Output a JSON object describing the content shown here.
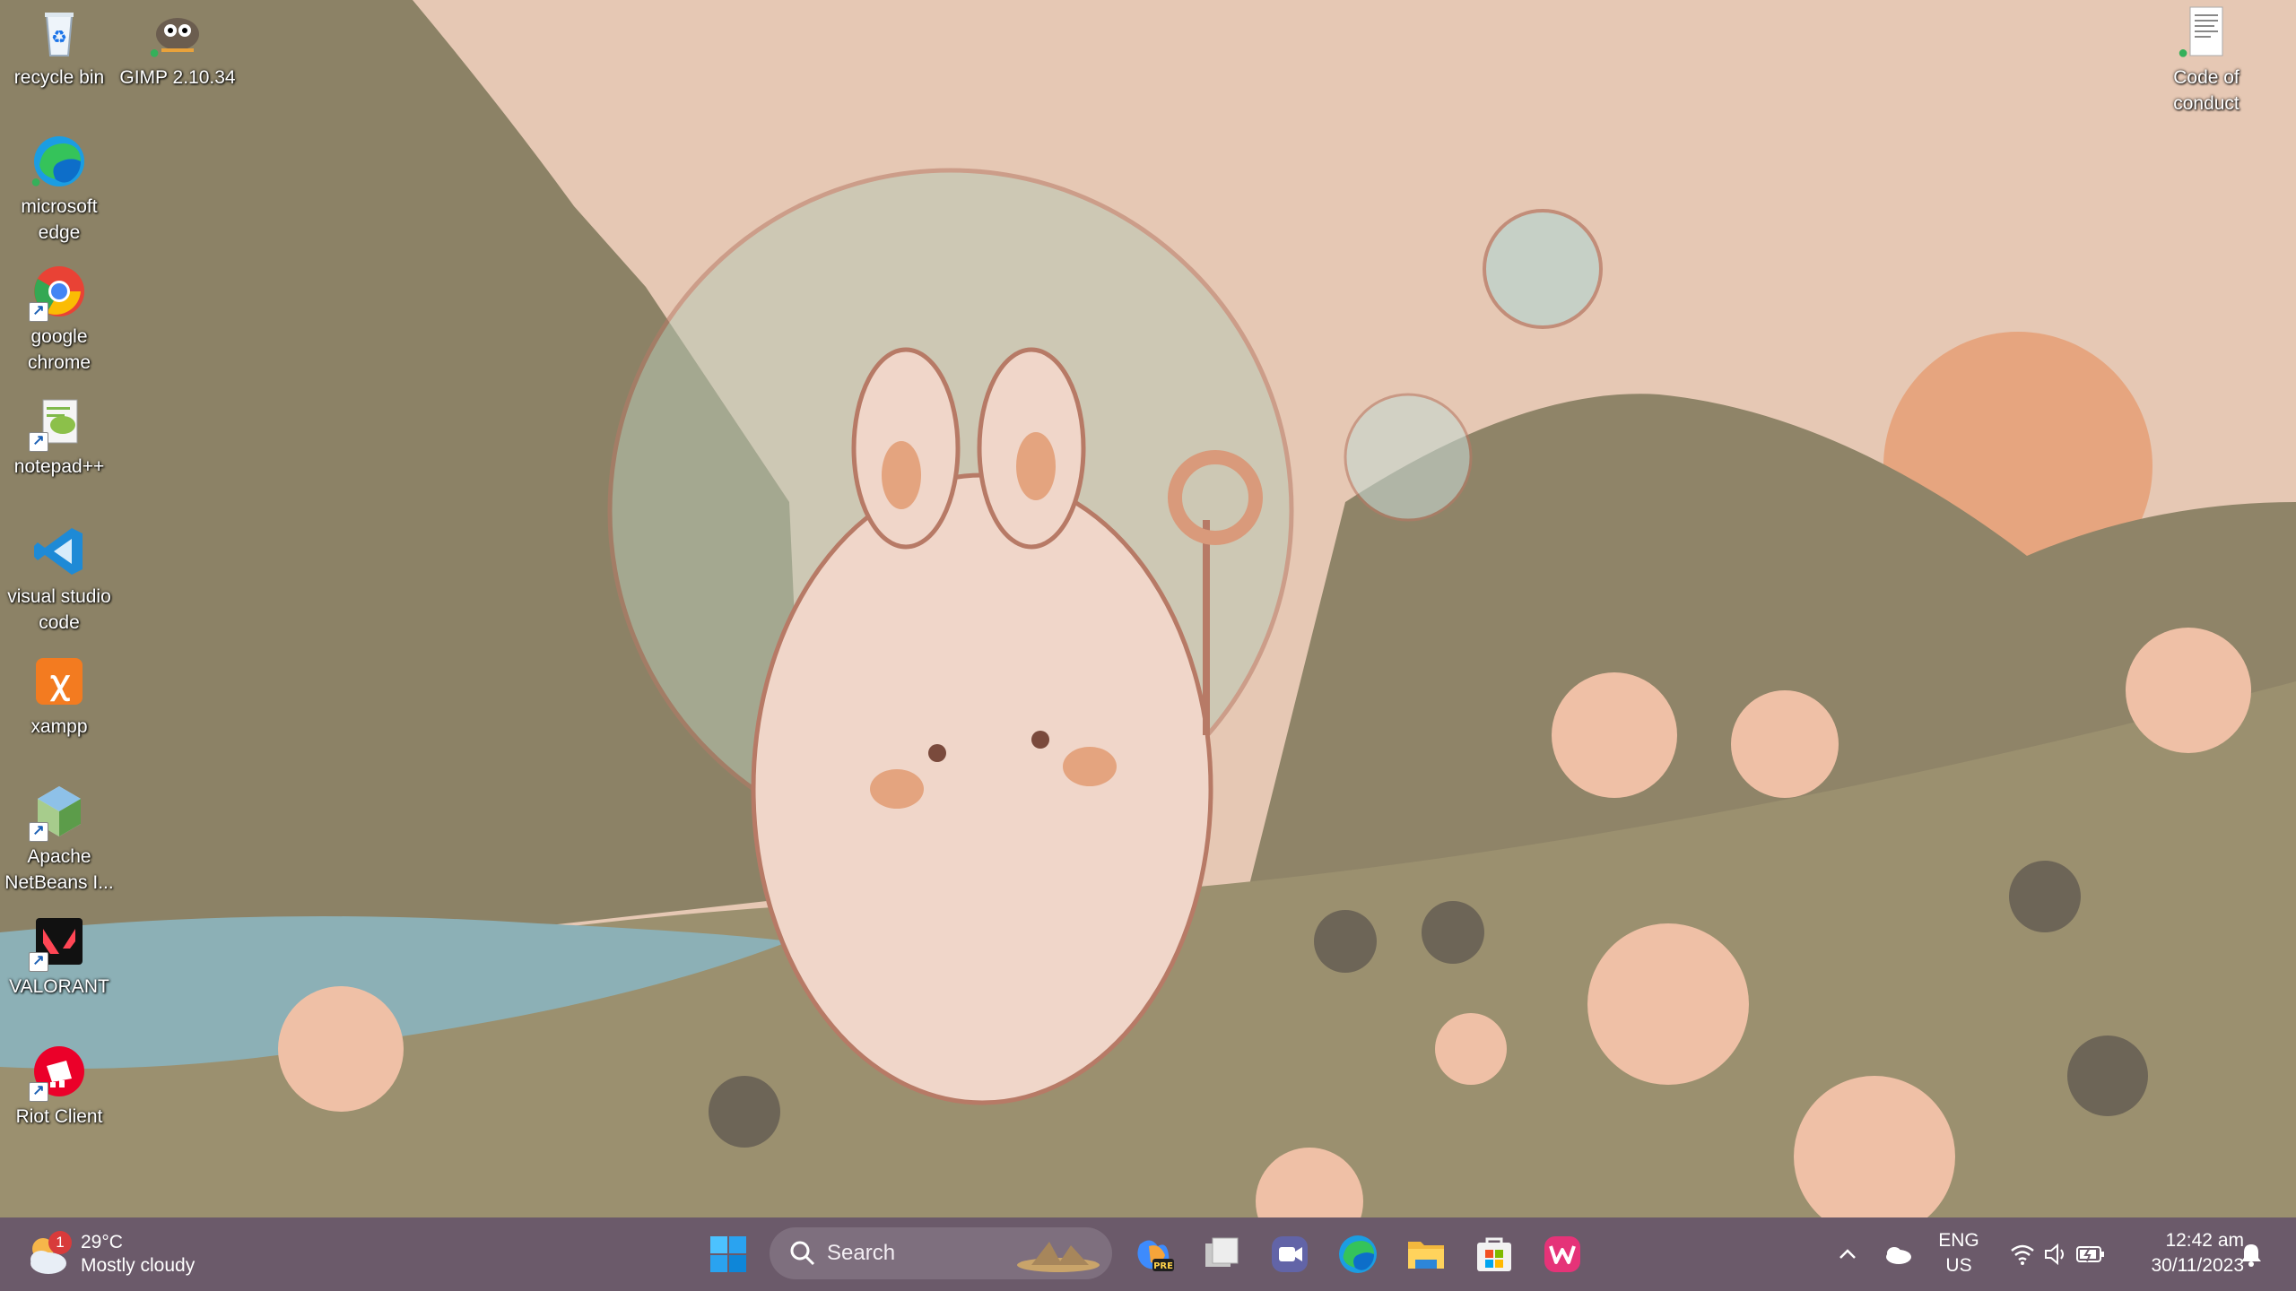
{
  "desktop": {
    "icons_left": [
      {
        "label": "recycle bin",
        "icon": "recycle-bin-icon"
      },
      {
        "label": "GIMP 2.10.34",
        "icon": "gimp-icon"
      },
      {
        "label": "microsoft edge",
        "icon": "edge-icon"
      },
      {
        "label": "google chrome",
        "icon": "chrome-icon"
      },
      {
        "label": "notepad++",
        "icon": "notepad-plus-plus-icon"
      },
      {
        "label": "visual studio code",
        "icon": "vscode-icon"
      },
      {
        "label": "xampp",
        "icon": "xampp-icon"
      },
      {
        "label": "Apache NetBeans I...",
        "icon": "netbeans-icon"
      },
      {
        "label": "VALORANT",
        "icon": "valorant-icon"
      },
      {
        "label": "Riot Client",
        "icon": "riot-client-icon"
      }
    ],
    "icons_right": [
      {
        "label": "Code of conduct",
        "icon": "document-icon"
      }
    ]
  },
  "taskbar": {
    "weather": {
      "temp": "29°C",
      "condition": "Mostly cloudy",
      "badge": "1"
    },
    "search": {
      "label": "Search"
    },
    "pinned": [
      "start-icon",
      "copilot-pre-icon",
      "task-view-icon",
      "teams-meet-icon",
      "edge-icon",
      "file-explorer-icon",
      "microsoft-store-icon",
      "wps-office-icon"
    ],
    "tray": {
      "lang_top": "ENG",
      "lang_bottom": "US",
      "time": "12:42 am",
      "date": "30/11/2023"
    }
  },
  "colors": {
    "taskbar_bg": "#6b5a6a",
    "sky": "#e7c9b5",
    "hill": "#8f8468",
    "accent": "#0078d4"
  }
}
